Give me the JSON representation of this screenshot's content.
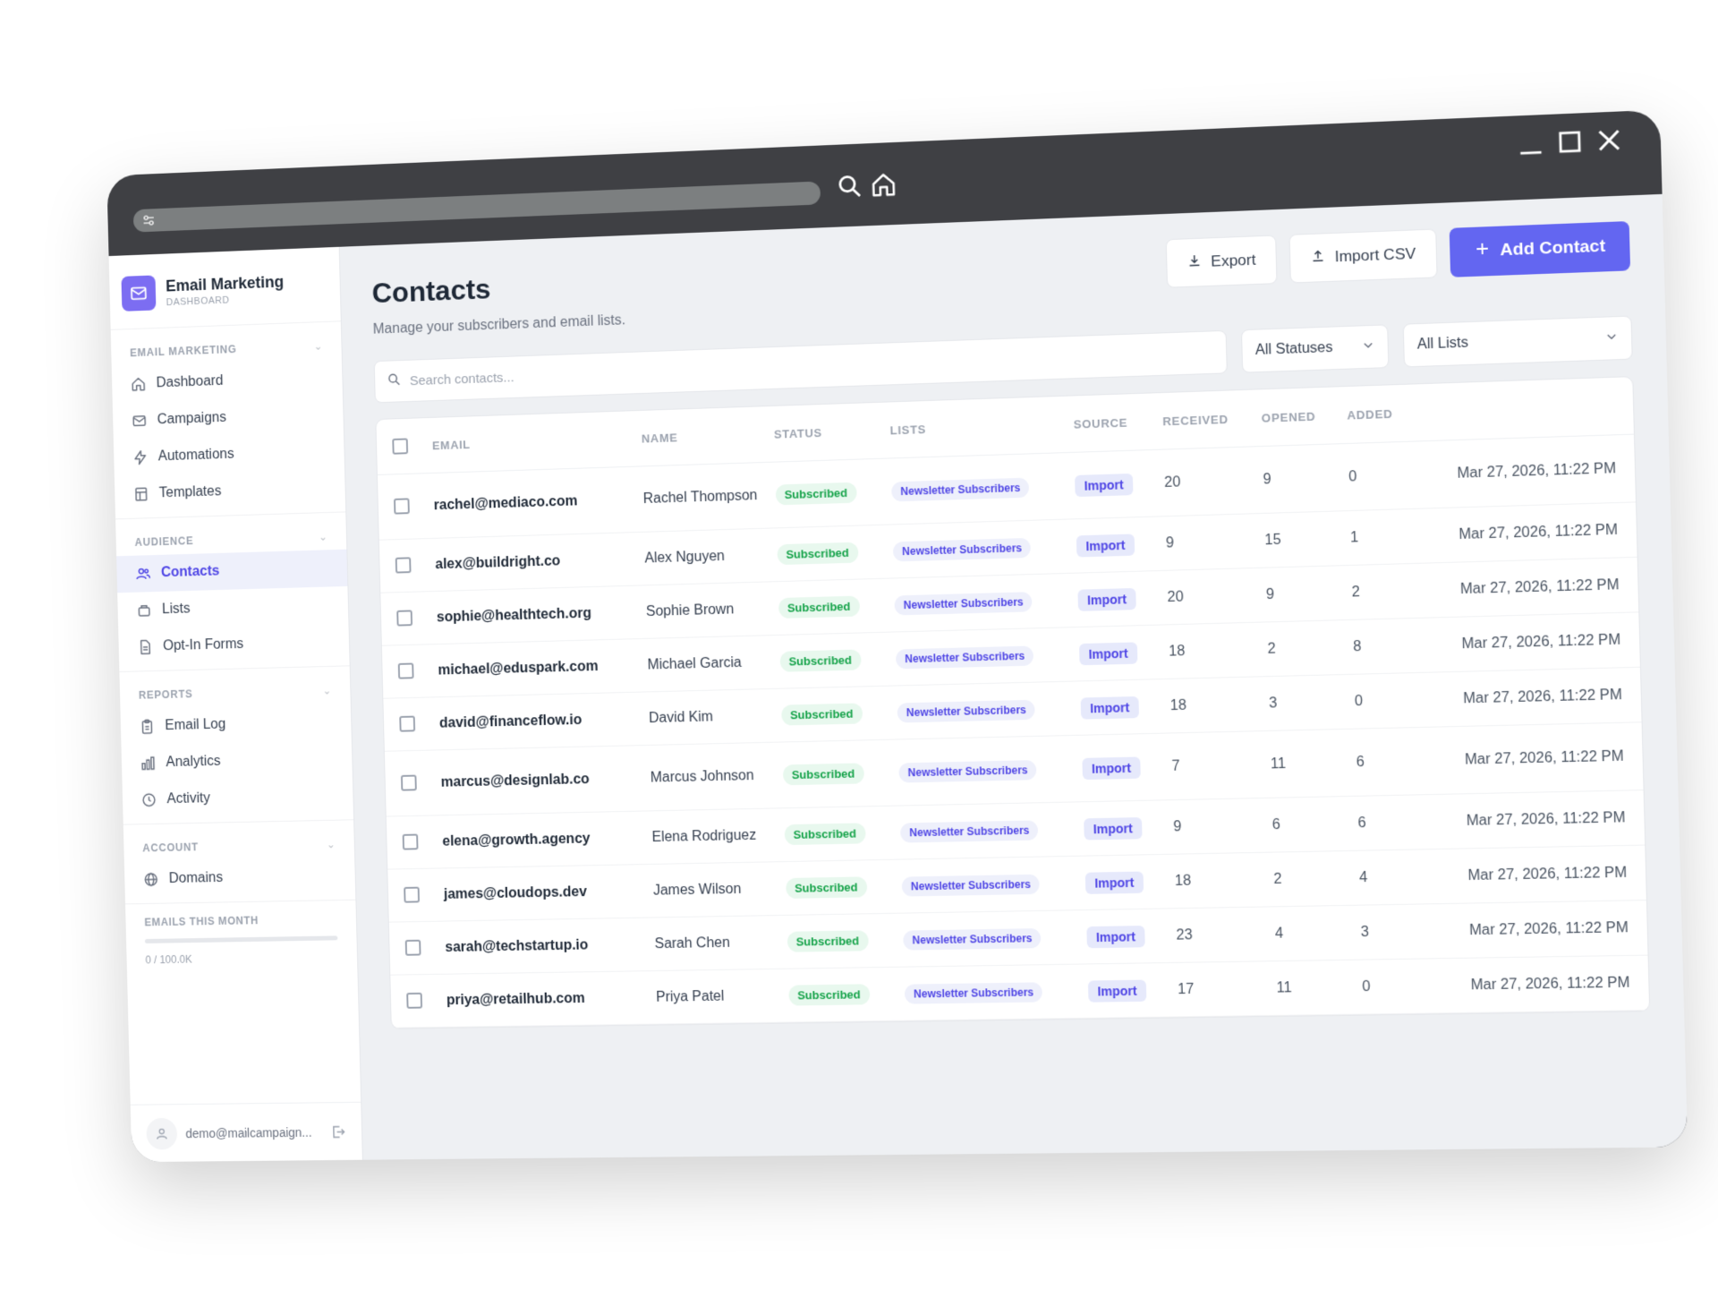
{
  "app": {
    "brand_title": "Email Marketing",
    "brand_subtitle": "DASHBOARD"
  },
  "sidebar": {
    "sections": [
      {
        "label": "EMAIL MARKETING",
        "items": [
          {
            "label": "Dashboard",
            "icon": "home-icon"
          },
          {
            "label": "Campaigns",
            "icon": "mail-icon"
          },
          {
            "label": "Automations",
            "icon": "bolt-icon"
          },
          {
            "label": "Templates",
            "icon": "template-icon"
          }
        ]
      },
      {
        "label": "AUDIENCE",
        "items": [
          {
            "label": "Contacts",
            "icon": "users-icon",
            "active": true
          },
          {
            "label": "Lists",
            "icon": "list-icon"
          },
          {
            "label": "Opt-In Forms",
            "icon": "form-icon"
          }
        ]
      },
      {
        "label": "REPORTS",
        "items": [
          {
            "label": "Email Log",
            "icon": "log-icon"
          },
          {
            "label": "Analytics",
            "icon": "chart-icon"
          },
          {
            "label": "Activity",
            "icon": "clock-icon"
          }
        ]
      },
      {
        "label": "ACCOUNT",
        "items": [
          {
            "label": "Domains",
            "icon": "globe-icon"
          }
        ]
      }
    ],
    "usage_label": "EMAILS THIS MONTH",
    "usage_value": "0 / 100.0K",
    "usage_fraction": 0,
    "user_email": "demo@mailcampaign..."
  },
  "page": {
    "title": "Contacts",
    "subtitle": "Manage your subscribers and email lists.",
    "export_label": "Export",
    "import_label": "Import CSV",
    "add_label": "Add Contact",
    "search_placeholder": "Search contacts...",
    "status_filter": "All Statuses",
    "lists_filter": "All Lists"
  },
  "table": {
    "columns": [
      "EMAIL",
      "NAME",
      "STATUS",
      "LISTS",
      "SOURCE",
      "RECEIVED",
      "OPENED",
      "ADDED"
    ],
    "rows": [
      {
        "email": "rachel@mediaco.com",
        "name": "Rachel Thompson",
        "status": "Subscribed",
        "list": "Newsletter Subscribers",
        "source": "Import",
        "received": "20",
        "opened": "9",
        "clicked": "0",
        "added": "Mar 27, 2026, 11:22 PM"
      },
      {
        "email": "alex@buildright.co",
        "name": "Alex Nguyen",
        "status": "Subscribed",
        "list": "Newsletter Subscribers",
        "source": "Import",
        "received": "9",
        "opened": "15",
        "clicked": "1",
        "added": "Mar 27, 2026, 11:22 PM"
      },
      {
        "email": "sophie@healthtech.org",
        "name": "Sophie Brown",
        "status": "Subscribed",
        "list": "Newsletter Subscribers",
        "source": "Import",
        "received": "20",
        "opened": "9",
        "clicked": "2",
        "added": "Mar 27, 2026, 11:22 PM"
      },
      {
        "email": "michael@eduspark.com",
        "name": "Michael Garcia",
        "status": "Subscribed",
        "list": "Newsletter Subscribers",
        "source": "Import",
        "received": "18",
        "opened": "2",
        "clicked": "8",
        "added": "Mar 27, 2026, 11:22 PM"
      },
      {
        "email": "david@financeflow.io",
        "name": "David Kim",
        "status": "Subscribed",
        "list": "Newsletter Subscribers",
        "source": "Import",
        "received": "18",
        "opened": "3",
        "clicked": "0",
        "added": "Mar 27, 2026, 11:22 PM"
      },
      {
        "email": "marcus@designlab.co",
        "name": "Marcus Johnson",
        "status": "Subscribed",
        "list": "Newsletter Subscribers",
        "source": "Import",
        "received": "7",
        "opened": "11",
        "clicked": "6",
        "added": "Mar 27, 2026, 11:22 PM"
      },
      {
        "email": "elena@growth.agency",
        "name": "Elena Rodriguez",
        "status": "Subscribed",
        "list": "Newsletter Subscribers",
        "source": "Import",
        "received": "9",
        "opened": "6",
        "clicked": "6",
        "added": "Mar 27, 2026, 11:22 PM"
      },
      {
        "email": "james@cloudops.dev",
        "name": "James Wilson",
        "status": "Subscribed",
        "list": "Newsletter Subscribers",
        "source": "Import",
        "received": "18",
        "opened": "2",
        "clicked": "4",
        "added": "Mar 27, 2026, 11:22 PM"
      },
      {
        "email": "sarah@techstartup.io",
        "name": "Sarah Chen",
        "status": "Subscribed",
        "list": "Newsletter Subscribers",
        "source": "Import",
        "received": "23",
        "opened": "4",
        "clicked": "3",
        "added": "Mar 27, 2026, 11:22 PM"
      },
      {
        "email": "priya@retailhub.com",
        "name": "Priya Patel",
        "status": "Subscribed",
        "list": "Newsletter Subscribers",
        "source": "Import",
        "received": "17",
        "opened": "11",
        "clicked": "0",
        "added": "Mar 27, 2026, 11:22 PM"
      }
    ]
  },
  "colors": {
    "accent": "#6366f1",
    "chrome": "#3f4044",
    "subscribed_text": "#16a34a",
    "subscribed_bg": "#e8f8ee"
  }
}
